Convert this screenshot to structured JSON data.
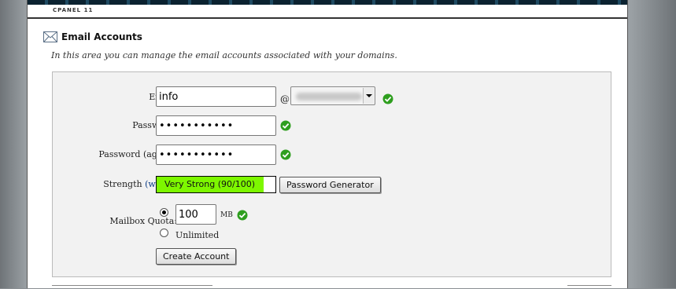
{
  "brand": "CPANEL 11",
  "page": {
    "title": "Email Accounts",
    "description": "In this area you can manage the email accounts associated with your domains."
  },
  "form": {
    "email_label": "Email:",
    "email_value": "info",
    "at_sign": "@",
    "password_label": "Password:",
    "password_value": "•••••••••••",
    "password_again_label": "Password (again):",
    "password_again_value": "•••••••••••",
    "strength_label": "Strength",
    "why_link": "(why?)",
    "strength_colon": ":",
    "strength_text": "Very Strong (90/100)",
    "strength_score": 90,
    "password_generator_button": "Password Generator",
    "quota_label": "Mailbox Quota:",
    "quota_value": "100",
    "quota_unit": "MB",
    "unlimited_label": "Unlimited",
    "quota_selected": "value",
    "create_button": "Create Account"
  },
  "colors": {
    "strength_fill": "#7df700",
    "check": "#2e9e1e"
  }
}
